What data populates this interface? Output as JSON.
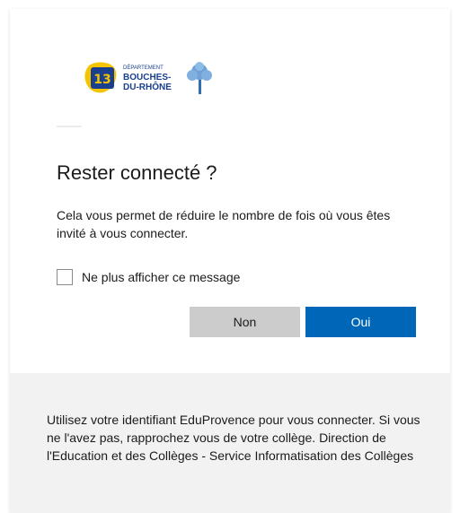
{
  "organization": {
    "logo_line1": "DÉPARTEMENT",
    "logo_line2": "BOUCHES-",
    "logo_line3": "DU-RHÔNE",
    "logo_badge": "13"
  },
  "dialog": {
    "title": "Rester connecté ?",
    "description": "Cela vous permet de réduire le nombre de fois où vous êtes invité à vous connecter.",
    "checkbox_label": "Ne plus afficher ce message",
    "checkbox_checked": false,
    "no_button": "Non",
    "yes_button": "Oui"
  },
  "footer": {
    "text": "Utilisez votre identifiant EduProvence pour vous connecter. Si vous ne l'avez pas, rapprochez vous de votre collège. Direction de l'Education et des Collèges - Service Informatisation des Collèges"
  },
  "colors": {
    "primary": "#0067b8",
    "secondary_button": "#cccccc",
    "footer_background": "#f2f2f2",
    "logo_blue": "#1a3f8f",
    "logo_yellow": "#f5c400"
  }
}
